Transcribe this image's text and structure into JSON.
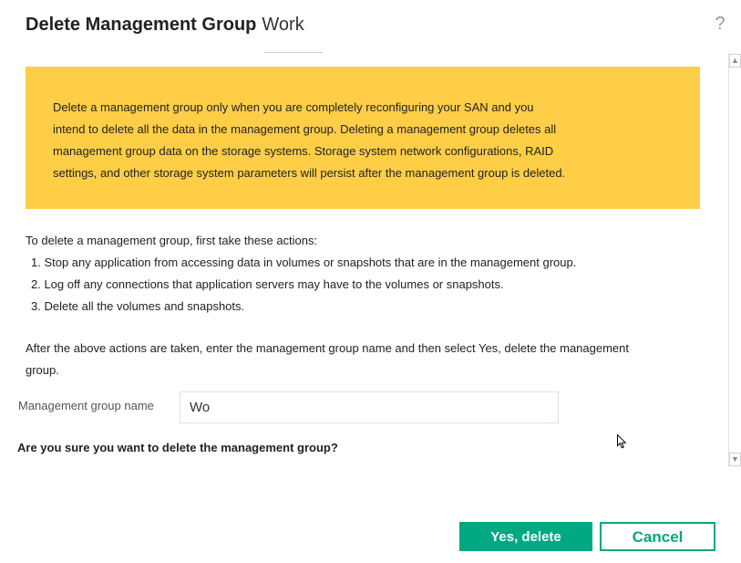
{
  "dialog": {
    "title": "Delete Management Group",
    "group_name": "Work",
    "help_icon": "question-mark-icon"
  },
  "warning": {
    "lines": [
      "Delete a management group only when you are completely reconfiguring your SAN and you",
      "intend to delete all the data in the management group. Deleting a management group deletes all",
      "management group data on the storage systems. Storage system network configurations, RAID",
      "settings, and other storage system parameters will persist after the management group is deleted."
    ],
    "background_color": "#fece47"
  },
  "instructions": {
    "intro": "To delete a management group, first take these actions:",
    "steps": [
      "1. Stop any application from accessing data in volumes or snapshots that are in the management group.",
      "2. Log off any connections that application servers may have to the volumes or snapshots.",
      "3. Delete all the volumes and snapshots."
    ],
    "after_lines": [
      "After the above actions are taken, enter the management group name and then select Yes, delete the management",
      "group."
    ]
  },
  "form": {
    "name_label": "Management group name",
    "name_value": "Wo",
    "confirm_question": "Are you sure you want to delete the management group?"
  },
  "scrollbar": {
    "up_icon": "scroll-up-arrow-icon",
    "down_icon": "scroll-down-arrow-icon"
  },
  "buttons": {
    "yes_label": "Yes, delete",
    "cancel_label": "Cancel",
    "accent_color": "#01a982"
  }
}
